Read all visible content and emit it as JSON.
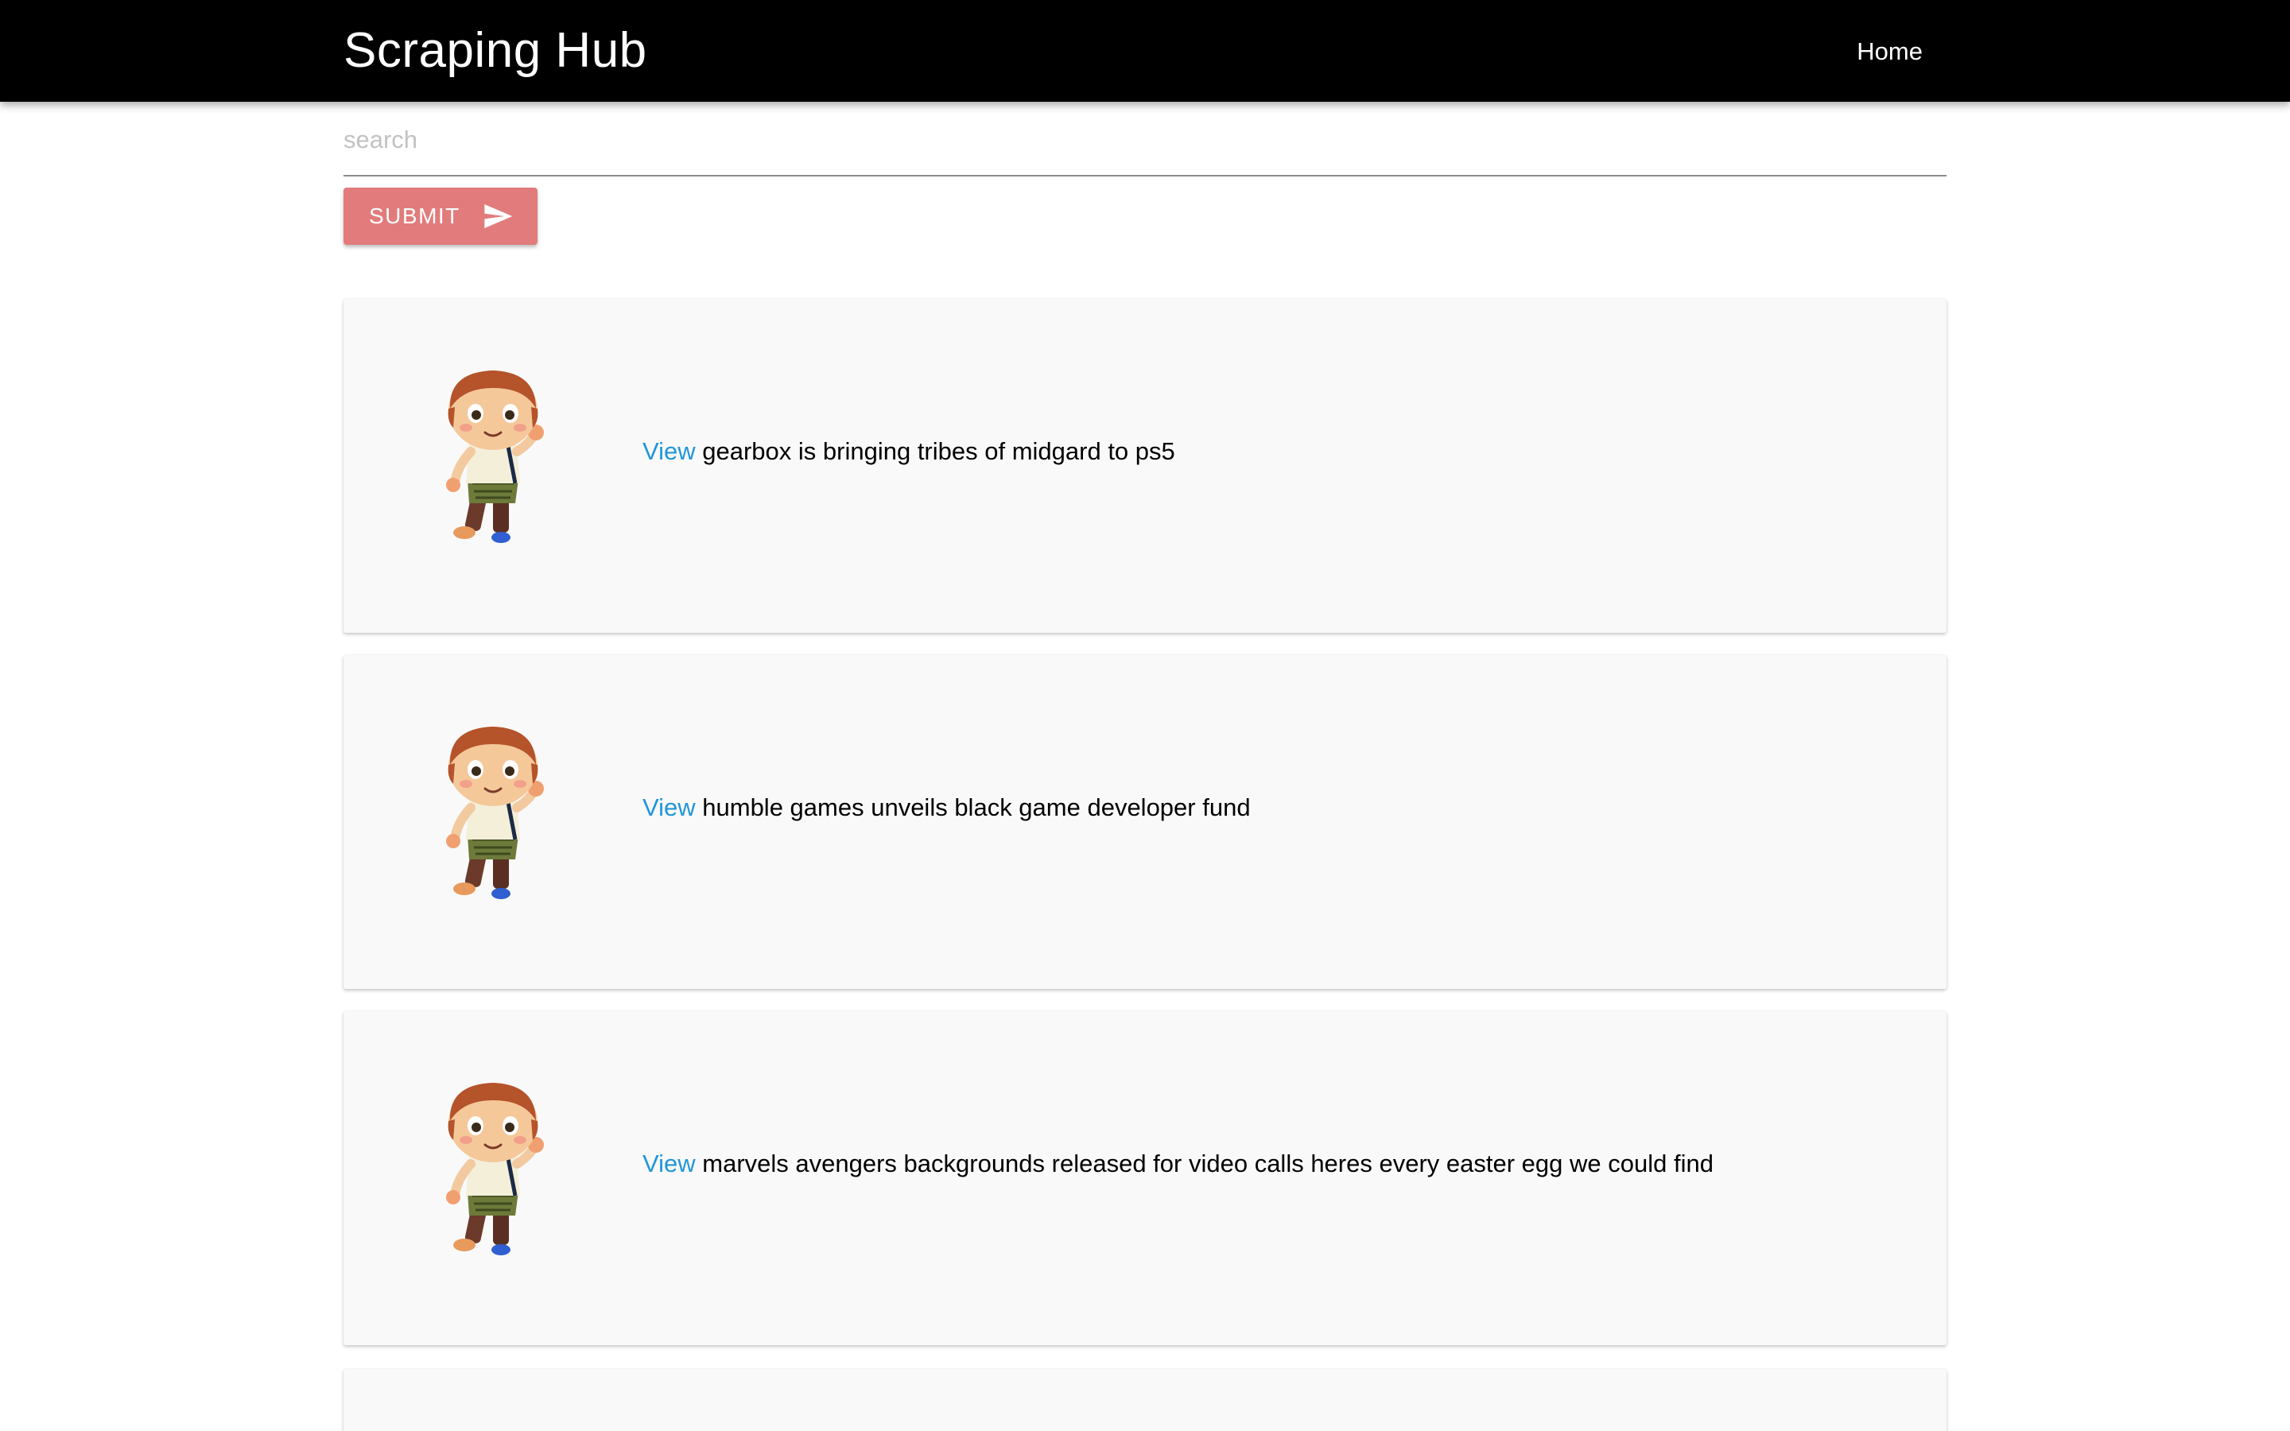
{
  "navbar": {
    "brand": "Scraping Hub",
    "home_label": "Home",
    "background": "#000000"
  },
  "search": {
    "placeholder": "search",
    "value": ""
  },
  "submit": {
    "label": "SUBMIT",
    "icon": "send-icon",
    "color": "#e27b7b"
  },
  "articles": [
    {
      "link_label": "View",
      "title": "gearbox is bringing tribes of midgard to ps5",
      "image": "villager-character-image"
    },
    {
      "link_label": "View",
      "title": "humble games unveils black game developer fund",
      "image": "villager-character-image"
    },
    {
      "link_label": "View",
      "title": "marvels avengers backgrounds released for video calls heres every easter egg we could find",
      "image": "villager-character-image"
    },
    {
      "link_label": "",
      "title": "",
      "image": ""
    }
  ],
  "colors": {
    "link": "#2196d9",
    "card_background": "#f9f9f9"
  }
}
